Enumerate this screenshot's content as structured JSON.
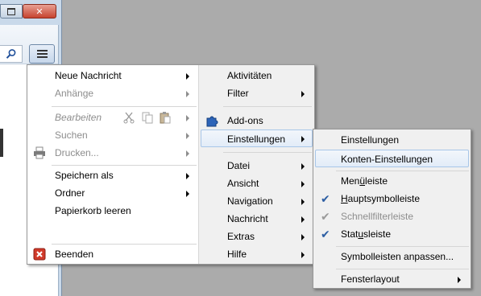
{
  "main_menu": {
    "left": [
      {
        "label": "Neue Nachricht",
        "arrow": true,
        "enabled": true
      },
      {
        "label": "Anhänge",
        "arrow": true,
        "enabled": false
      },
      {
        "label": "Bearbeiten",
        "arrow": true,
        "enabled": false
      },
      {
        "label": "Suchen",
        "arrow": true,
        "enabled": false
      },
      {
        "label": "Drucken...",
        "arrow": true,
        "enabled": false
      },
      {
        "label": "Speichern als",
        "arrow": true,
        "enabled": true
      },
      {
        "label": "Ordner",
        "arrow": true,
        "enabled": true
      },
      {
        "label": "Papierkorb leeren",
        "arrow": false,
        "enabled": true
      },
      {
        "label": "Beenden",
        "arrow": false,
        "enabled": true
      }
    ],
    "right": [
      {
        "label": "Aktivitäten",
        "arrow": false
      },
      {
        "label": "Filter",
        "arrow": true
      },
      {
        "label": "Add-ons",
        "arrow": false
      },
      {
        "label": "Einstellungen",
        "arrow": true
      },
      {
        "label": "Datei",
        "arrow": true
      },
      {
        "label": "Ansicht",
        "arrow": true
      },
      {
        "label": "Navigation",
        "arrow": true
      },
      {
        "label": "Nachricht",
        "arrow": true
      },
      {
        "label": "Extras",
        "arrow": true
      },
      {
        "label": "Hilfe",
        "arrow": true
      }
    ]
  },
  "sub_menu": {
    "einstellungen": "Einstellungen",
    "konten": "Konten-Einstellungen",
    "menuleiste_pre": "Men",
    "menuleiste_ul": "ü",
    "menuleiste_post": "leiste",
    "haupt_ul": "H",
    "haupt_post": "auptsymbolleiste",
    "schnellfilter": "Schnellfilterleiste",
    "status_pre": "Stat",
    "status_ul": "u",
    "status_post": "sleiste",
    "anpassen": "Symbolleisten anpassen...",
    "fensterlayout": "Fensterlayout"
  },
  "checked": {
    "hauptsymbolleiste": true,
    "schnellfilterleiste": true,
    "statusleiste": true
  },
  "colors": {
    "highlight_border": "#a8c6e8",
    "check": "#2c5ea3",
    "disabled": "#8d8d8d"
  },
  "icons": [
    "restore-icon",
    "close-icon",
    "search-icon",
    "hamburger-menu-icon",
    "cut-icon",
    "copy-icon",
    "paste-icon",
    "printer-icon",
    "puzzle-icon",
    "quit-icon",
    "checkmark-icon"
  ]
}
